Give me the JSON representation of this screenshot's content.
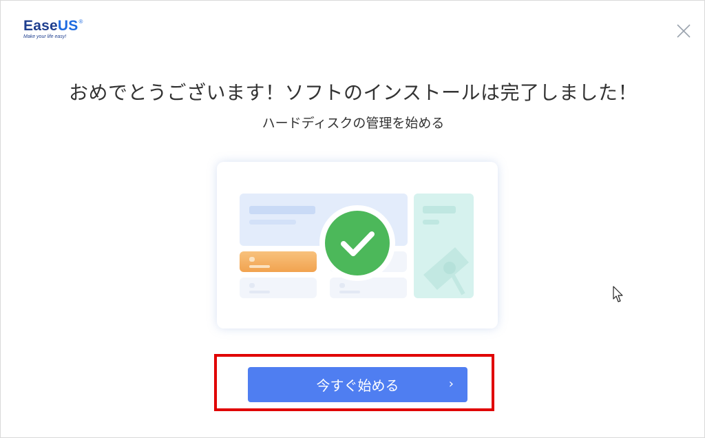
{
  "brand": {
    "name_part1": "Ease",
    "name_part2": "US",
    "registered": "®",
    "tagline": "Make your life easy!"
  },
  "header": {
    "title": "おめでとうございます！ソフトのインストールは完了しました！",
    "subtitle": "ハードディスクの管理を始める"
  },
  "action": {
    "start_label": "今すぐ始める",
    "chevron": "›"
  },
  "colors": {
    "accent": "#4f7ef1",
    "success": "#4cb85a",
    "highlight_border": "#e00000",
    "brand_dark": "#1f3f8f"
  },
  "icons": {
    "close": "close-icon",
    "check": "check-icon",
    "cursor": "mouse-cursor-icon"
  }
}
